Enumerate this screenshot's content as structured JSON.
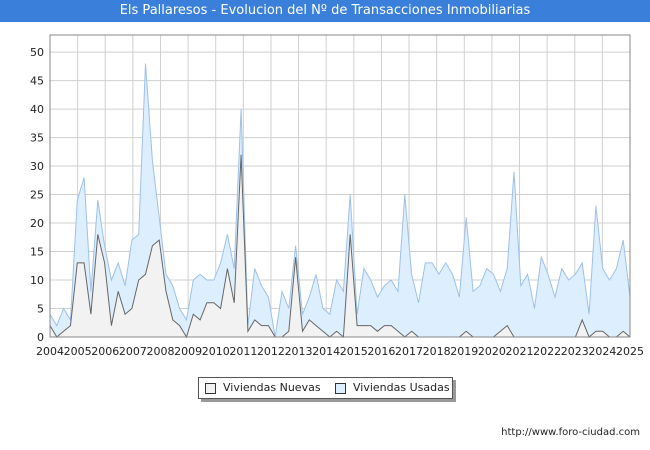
{
  "header": {
    "title": "Els Pallaresos - Evolucion del Nº de Transacciones Inmobiliarias"
  },
  "footer": {
    "url": "http://www.foro-ciudad.com"
  },
  "colors": {
    "title_bar": "#3a7fd9",
    "nuevas_line": "#666666",
    "nuevas_fill": "#f2f2f2",
    "usadas_line": "#9ec1e6",
    "usadas_fill": "#ddeeff",
    "grid": "#d0d0d0"
  },
  "chart_data": {
    "type": "area",
    "title": "Els Pallaresos - Evolucion del Nº de Transacciones Inmobiliarias",
    "xlabel": "",
    "ylabel": "",
    "x_ticks": [
      "2004",
      "2005",
      "2006",
      "2007",
      "2008",
      "2009",
      "2010",
      "2011",
      "2012",
      "2013",
      "2014",
      "2015",
      "2016",
      "2017",
      "2018",
      "2019",
      "2020",
      "2021",
      "2022",
      "2023",
      "2024",
      "2025"
    ],
    "x_range": [
      2004,
      2025
    ],
    "ylim": [
      0,
      53
    ],
    "y_ticks": [
      0,
      5,
      10,
      15,
      20,
      25,
      30,
      35,
      40,
      45,
      50
    ],
    "grid": true,
    "legend_position": "bottom-center",
    "series": [
      {
        "name": "Viviendas Nuevas",
        "values": [
          2,
          0,
          1,
          2,
          13,
          13,
          4,
          18,
          13,
          2,
          8,
          4,
          5,
          10,
          11,
          16,
          17,
          8,
          3,
          2,
          0,
          4,
          3,
          6,
          6,
          5,
          12,
          6,
          32,
          1,
          3,
          2,
          2,
          0,
          0,
          1,
          14,
          1,
          3,
          2,
          1,
          0,
          1,
          0,
          18,
          2,
          2,
          2,
          1,
          2,
          2,
          1,
          0,
          1,
          0,
          0,
          0,
          0,
          0,
          0,
          0,
          1,
          0,
          0,
          0,
          0,
          1,
          2,
          0,
          0,
          0,
          0,
          0,
          0,
          0,
          0,
          0,
          0,
          3,
          0,
          1,
          1,
          0,
          0,
          1,
          0
        ]
      },
      {
        "name": "Viviendas Usadas",
        "values": [
          4,
          2,
          5,
          3,
          24,
          28,
          8,
          24,
          16,
          10,
          13,
          9,
          17,
          18,
          48,
          31,
          21,
          11,
          9,
          5,
          3,
          10,
          11,
          10,
          10,
          13,
          18,
          12,
          40,
          2,
          12,
          9,
          7,
          0,
          8,
          5,
          16,
          4,
          7,
          11,
          5,
          4,
          10,
          8,
          25,
          4,
          12,
          10,
          7,
          9,
          10,
          8,
          25,
          11,
          6,
          13,
          13,
          11,
          13,
          11,
          7,
          21,
          8,
          9,
          12,
          11,
          8,
          12,
          29,
          9,
          11,
          5,
          14,
          11,
          7,
          12,
          10,
          11,
          13,
          4,
          23,
          12,
          10,
          12,
          17,
          7
        ]
      }
    ]
  }
}
